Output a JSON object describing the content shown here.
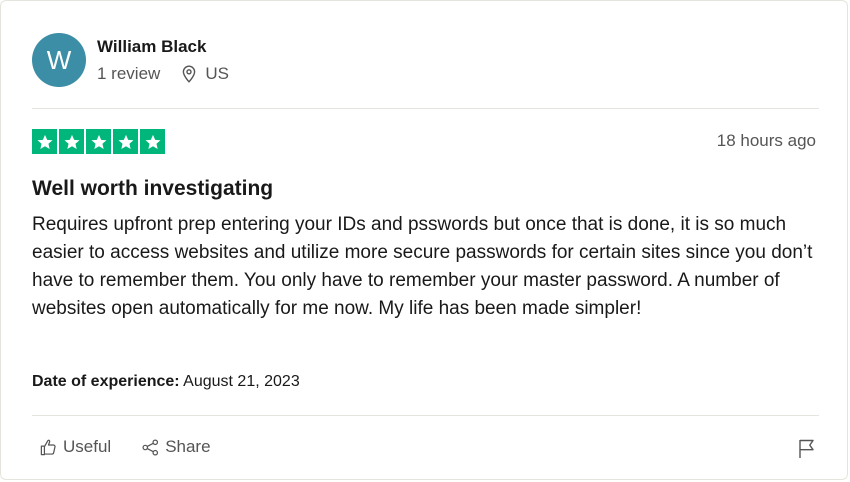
{
  "reviewer": {
    "avatar_letter": "W",
    "avatar_color": "#3b8ea5",
    "name": "William Black",
    "review_count": "1 review",
    "country": "US"
  },
  "review": {
    "rating": 5,
    "star_color": "#00b67a",
    "time_ago": "18 hours ago",
    "title": "Well worth investigating",
    "body": "Requires upfront prep entering your IDs and psswords but once that is done, it is so much easier to access websites and utilize more secure passwords for certain sites since you don’t have to remember them. You only have to remember your master password. A number of websites open automatically for me now. My life has been made simpler!",
    "experience_label": "Date of experience:",
    "experience_date": "August 21, 2023"
  },
  "actions": {
    "useful_label": "Useful",
    "share_label": "Share"
  },
  "icons": {
    "location": "location-pin-icon",
    "useful": "thumbs-up-icon",
    "share": "share-icon",
    "report": "flag-icon"
  }
}
